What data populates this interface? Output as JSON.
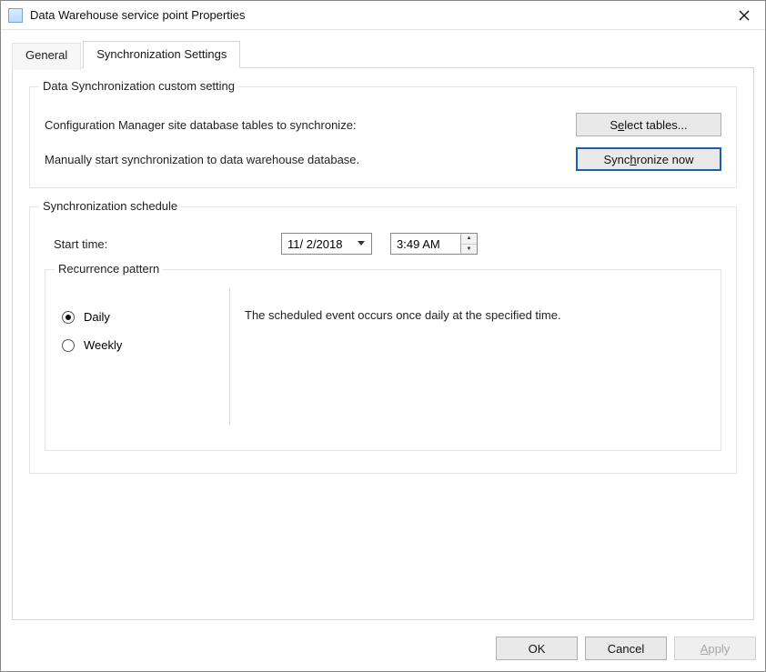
{
  "window": {
    "title": "Data Warehouse service point Properties"
  },
  "tabs": {
    "general": "General",
    "sync": "Synchronization Settings",
    "active": "sync"
  },
  "custom": {
    "group_title": "Data Synchronization custom setting",
    "config_label": "Configuration Manager site database tables to synchronize:",
    "select_tables_pre": "S",
    "select_tables_ul": "e",
    "select_tables_post": "lect tables...",
    "manual_label": "Manually start synchronization to data warehouse database.",
    "sync_now_pre": "Sync",
    "sync_now_ul": "h",
    "sync_now_post": "ronize now"
  },
  "schedule": {
    "group_title": "Synchronization schedule",
    "start_label": "Start time:",
    "date": "11/  2/2018",
    "time": "3:49 AM",
    "recurrence_title": "Recurrence pattern",
    "daily": "Daily",
    "weekly": "Weekly",
    "selected": "daily",
    "description": "The scheduled event occurs once daily at the specified time."
  },
  "footer": {
    "ok": "OK",
    "cancel": "Cancel",
    "apply_ul": "A",
    "apply_post": "pply"
  }
}
